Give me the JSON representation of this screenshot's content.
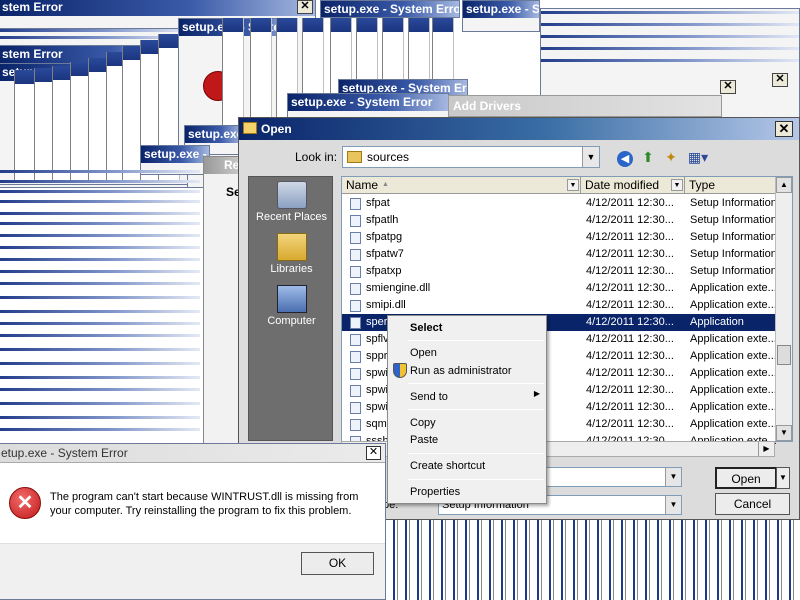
{
  "background_windows": {
    "title_short": "setup.exe - System Error",
    "title_truncated": "stem Error",
    "title_partial": "setup.exe - Syste",
    "add_drivers_title": "Add Drivers",
    "re_title": "Re",
    "re_text": "Se"
  },
  "open_dialog": {
    "title": "Open",
    "look_in_label": "Look in:",
    "look_in_value": "sources",
    "places": [
      {
        "label": "Recent Places",
        "icon": "recent-places-icon"
      },
      {
        "label": "Libraries",
        "icon": "libraries-icon"
      },
      {
        "label": "Computer",
        "icon": "computer-icon"
      }
    ],
    "columns": {
      "name": "Name",
      "date": "Date modified",
      "type": "Type"
    },
    "files": [
      {
        "name": "sfpat",
        "date": "4/12/2011 12:30...",
        "type": "Setup Information"
      },
      {
        "name": "sfpatlh",
        "date": "4/12/2011 12:30...",
        "type": "Setup Information"
      },
      {
        "name": "sfpatpg",
        "date": "4/12/2011 12:30...",
        "type": "Setup Information"
      },
      {
        "name": "sfpatw7",
        "date": "4/12/2011 12:30...",
        "type": "Setup Information"
      },
      {
        "name": "sfpatxp",
        "date": "4/12/2011 12:30...",
        "type": "Setup Information"
      },
      {
        "name": "smiengine.dll",
        "date": "4/12/2011 12:30...",
        "type": "Application exte..."
      },
      {
        "name": "smipi.dll",
        "date": "4/12/2011 12:30...",
        "type": "Application exte..."
      },
      {
        "name": "sperr32",
        "date": "4/12/2011 12:30...",
        "type": "Application",
        "selected": true
      },
      {
        "name": "spflv",
        "date": "4/12/2011 12:30...",
        "type": "Application exte..."
      },
      {
        "name": "sppr",
        "date": "4/12/2011 12:30...",
        "type": "Application exte..."
      },
      {
        "name": "spwi",
        "date": "4/12/2011 12:30...",
        "type": "Application exte..."
      },
      {
        "name": "spwi",
        "date": "4/12/2011 12:30...",
        "type": "Application exte..."
      },
      {
        "name": "spwi",
        "date": "4/12/2011 12:30...",
        "type": "Application exte..."
      },
      {
        "name": "sqma",
        "date": "4/12/2011 12:30...",
        "type": "Application exte..."
      },
      {
        "name": "sssh",
        "date": "4/12/2011 12:30...",
        "type": "Application exte..."
      }
    ],
    "file_type_label": "pe:",
    "file_type_value": "Setup Information",
    "open_label": "Open",
    "cancel_label": "Cancel"
  },
  "context_menu": {
    "select": "Select",
    "open": "Open",
    "run_as_admin": "Run as administrator",
    "send_to": "Send to",
    "copy": "Copy",
    "paste": "Paste",
    "create_shortcut": "Create shortcut",
    "properties": "Properties"
  },
  "error_dialog": {
    "title": "etup.exe - System Error",
    "message": "The program can't start because WINTRUST.dll is missing from your computer. Try reinstalling the program to fix this problem.",
    "ok_label": "OK"
  },
  "colors": {
    "title_blue": "#0a246a",
    "selection": "#0a246a",
    "error_red": "#c01818"
  }
}
